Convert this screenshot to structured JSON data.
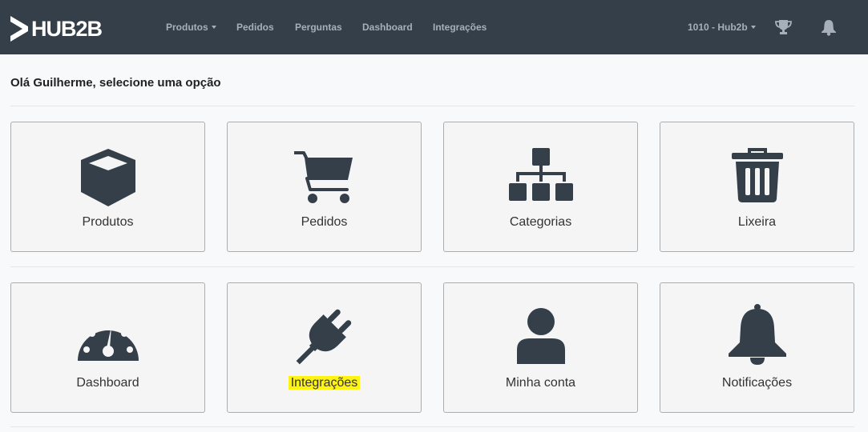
{
  "header": {
    "logo_text": "HUB2B",
    "nav": [
      {
        "label": "Produtos",
        "has_dropdown": true
      },
      {
        "label": "Pedidos",
        "has_dropdown": false
      },
      {
        "label": "Perguntas",
        "has_dropdown": false
      },
      {
        "label": "Dashboard",
        "has_dropdown": false
      },
      {
        "label": "Integrações",
        "has_dropdown": false
      }
    ],
    "account_label": "1010 - Hub2b",
    "icons": [
      "trophy-icon",
      "bell-icon"
    ]
  },
  "main": {
    "greeting": "Olá Guilherme, selecione uma opção",
    "cards": [
      {
        "label": "Produtos",
        "icon": "cube-icon"
      },
      {
        "label": "Pedidos",
        "icon": "cart-icon"
      },
      {
        "label": "Categorias",
        "icon": "sitemap-icon"
      },
      {
        "label": "Lixeira",
        "icon": "trash-icon"
      },
      {
        "label": "Dashboard",
        "icon": "gauge-icon"
      },
      {
        "label": "Integrações",
        "icon": "plug-icon",
        "highlighted": true
      },
      {
        "label": "Minha conta",
        "icon": "user-icon"
      },
      {
        "label": "Notificações",
        "icon": "bell-icon"
      }
    ]
  },
  "colors": {
    "navbar_bg": "#343f49",
    "nav_text": "#a7b0b8",
    "icon_dark": "#343f49",
    "card_bg": "#f5f5f5",
    "card_border": "#adadad",
    "highlight": "#fff314"
  }
}
